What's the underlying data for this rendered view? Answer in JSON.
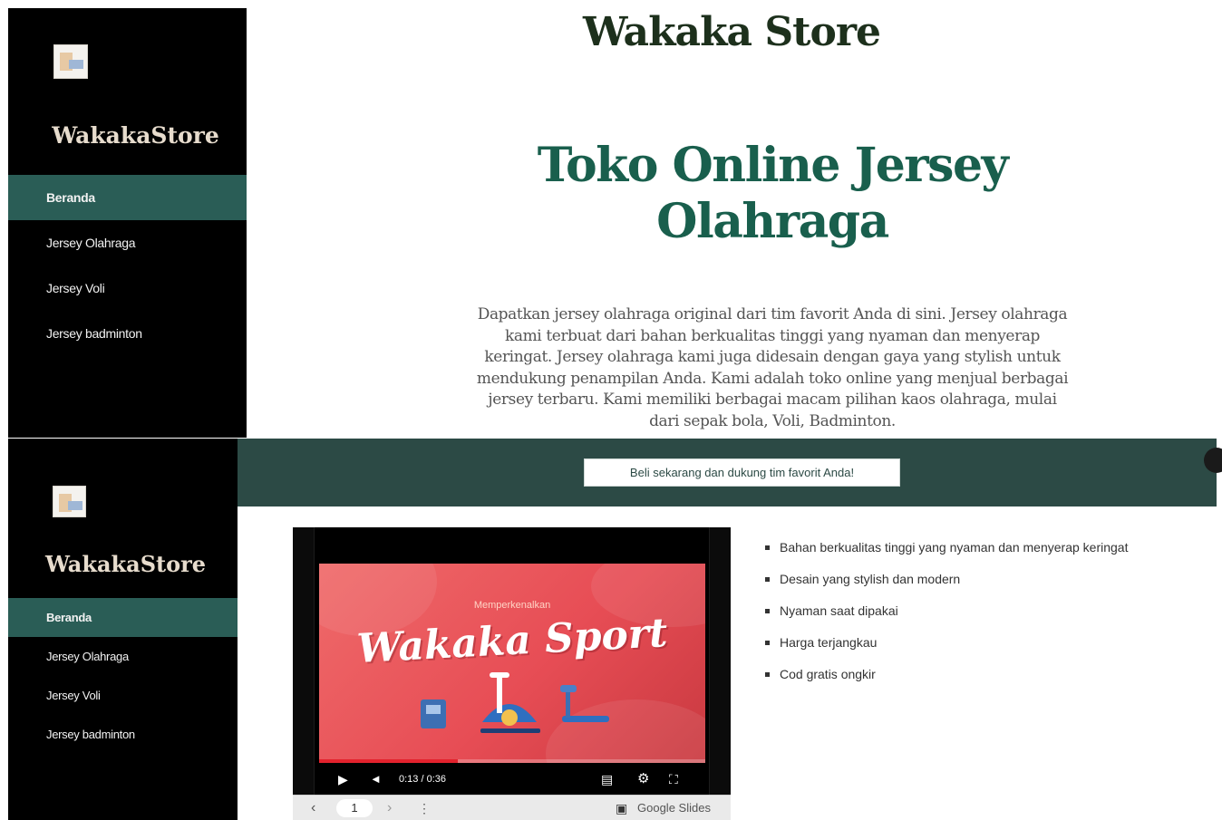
{
  "brand": "WakakaStore",
  "nav": {
    "items": [
      {
        "label": "Beranda"
      },
      {
        "label": "Jersey Olahraga"
      },
      {
        "label": "Jersey Voli"
      },
      {
        "label": "Jersey badminton"
      }
    ],
    "active": "Beranda"
  },
  "header": {
    "store_title": "Wakaka Store"
  },
  "hero": {
    "title_line1": "Toko Online Jersey",
    "title_line2": "Olahraga",
    "description": "Dapatkan jersey olahraga original dari tim favorit Anda di sini. Jersey olahraga kami terbuat dari bahan berkualitas tinggi yang nyaman dan menyerap keringat. Jersey olahraga kami juga didesain dengan gaya yang stylish untuk mendukung penampilan Anda. Kami adalah toko online yang menjual berbagai jersey terbaru. Kami memiliki berbagai macam pilihan kaos olahraga, mulai dari sepak bola, Voli, Badminton."
  },
  "banner": {
    "cta": "Beli sekarang dan dukung tim favorit Anda!"
  },
  "video": {
    "slide_subtitle": "Memperkenalkan",
    "slide_title": "Wakaka Sport",
    "time": "0:13 / 0:36",
    "progress": 0.36,
    "page_number": "1",
    "provider": "Google Slides",
    "icons": [
      "play-icon",
      "volume-icon",
      "captions-icon",
      "settings-icon",
      "fullscreen-icon",
      "prev-icon",
      "next-icon",
      "more-icon",
      "slides-icon"
    ]
  },
  "features": [
    "Bahan berkualitas tinggi yang nyaman dan menyerap keringat",
    "Desain yang stylish dan modern",
    "Nyaman saat dipakai",
    "Harga terjangkau",
    "Cod gratis ongkir"
  ],
  "colors": {
    "sidebar_bg": "#000000",
    "accent": "#2a5d56",
    "banner_bg": "#2c4a45",
    "hero_title": "#195f4d",
    "store_title": "#1d301c",
    "slide_red": "#e74d55"
  }
}
